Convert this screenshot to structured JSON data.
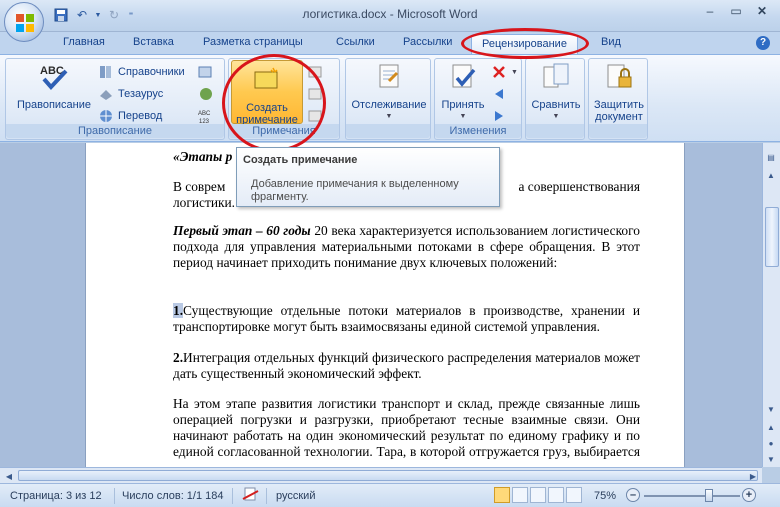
{
  "window": {
    "title": "логистика.docx - Microsoft Word"
  },
  "tabs": [
    {
      "label": "Главная"
    },
    {
      "label": "Вставка"
    },
    {
      "label": "Разметка страницы"
    },
    {
      "label": "Ссылки"
    },
    {
      "label": "Рассылки"
    },
    {
      "label": "Рецензирование",
      "active": true
    },
    {
      "label": "Вид"
    }
  ],
  "ribbon": {
    "spelling": {
      "label": "Правописание"
    },
    "references": {
      "label": "Справочники"
    },
    "thesaurus": {
      "label": "Тезаурус"
    },
    "translate": {
      "label": "Перевод"
    },
    "proofing_group": "Правописание",
    "new_comment": {
      "label_line1": "Создать",
      "label_line2": "примечание"
    },
    "comments_group": "Примечания",
    "tracking": {
      "label": "Отслеживание"
    },
    "accept": {
      "label": "Принять"
    },
    "changes_group": "Изменения",
    "compare": {
      "label": "Сравнить"
    },
    "protect": {
      "label_line1": "Защитить",
      "label_line2": "документ"
    }
  },
  "tooltip": {
    "title": "Создать примечание",
    "description": "Добавление примечания к выделенному фрагменту."
  },
  "document": {
    "heading_fragment": "«Этапы р",
    "p1_start": "В соврем",
    "p1_end": "а совершенствования",
    "p1_line2": "логистики.",
    "p2_bold": "Первый этап – 60 годы",
    "p2_text": " 20 века характеризуется использованием логистического подхода для управления материальными потоками в сфере обращения. В этот период начинает приходить понимание двух ключевых положений:",
    "p3_num": "1.",
    "p3_text": "Существующие отдельные потоки материалов в производстве, хранении и транспортировке могут быть взаимосвязаны единой системой управления.",
    "p4_num": "2.",
    "p4_text": "Интеграция отдельных функций физического распределения материалов может дать существенный экономический эффект.",
    "p5_text": "На этом этапе развития логистики транспорт и склад, прежде связанные лишь операцией погрузки и разгрузки, приобретают тесные взаимные связи. Они начинают работать на один экономический результат по единому графику и по единой согласованной технологии. Тара, в которой отгружается груз, выбирается с учетом применяемого транспорта, в свою очередь"
  },
  "status": {
    "page": "Страница: 3 из 12",
    "words": "Число слов: 1/1 184",
    "language": "русский",
    "zoom": "75%",
    "zoom_fraction": 0.68
  },
  "colors": {
    "highlight": "#d8151b",
    "accent": "#15428b"
  }
}
